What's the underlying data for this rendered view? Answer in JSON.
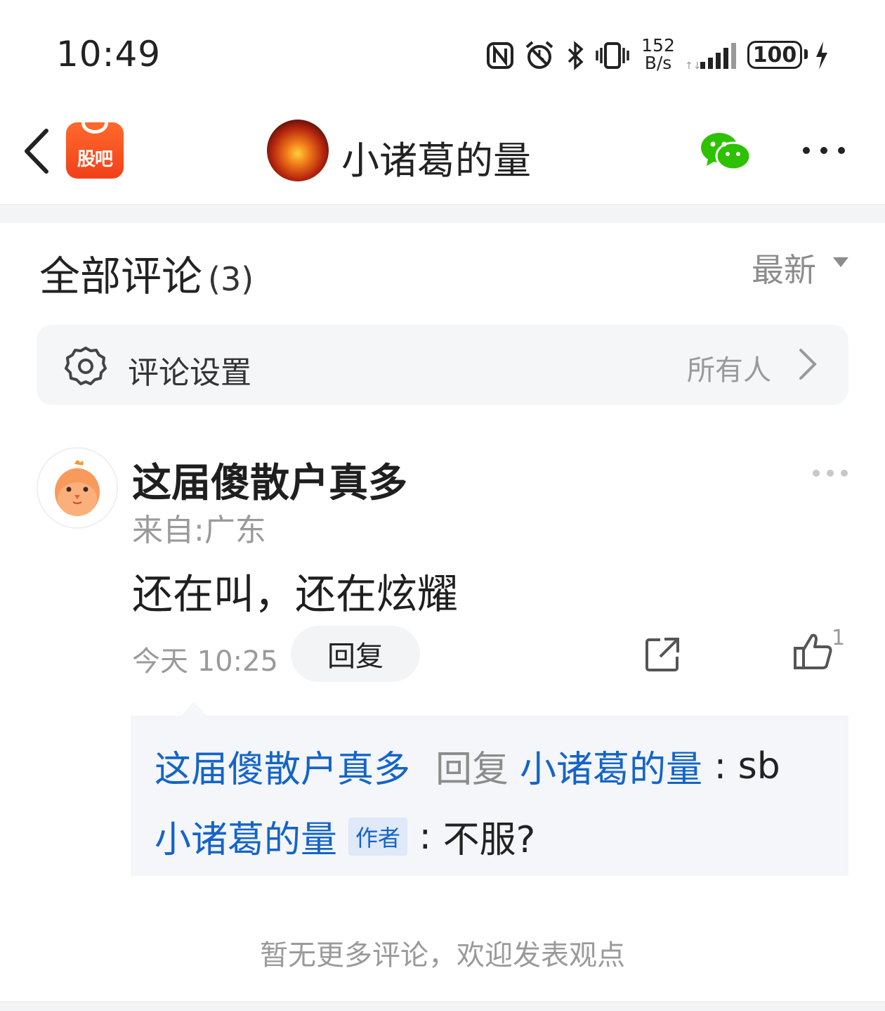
{
  "status_bar": {
    "time": "10:49",
    "net_speed_value": "152",
    "net_speed_unit": "B/s",
    "battery": "100",
    "icons": [
      "nfc-icon",
      "alarm-icon",
      "bluetooth-icon",
      "vibrate-icon",
      "signal-icon",
      "charging-icon"
    ]
  },
  "header": {
    "app_name": "股吧",
    "title": "小诸葛的量",
    "icons": [
      "back-arrow-icon",
      "wechat-icon",
      "more-icon"
    ],
    "app_color": "#f1401a"
  },
  "comments": {
    "title": "全部评论",
    "count": "(3)",
    "sort": "最新"
  },
  "settings": {
    "label": "评论设置",
    "value": "所有人"
  },
  "comment": {
    "author": "这届傻散户真多",
    "location": "来自:广东",
    "text": "还在叫，还在炫耀",
    "time": "今天 10:25",
    "reply_label": "回复",
    "like_count": "1"
  },
  "replies": [
    {
      "from": "这届傻散户真多",
      "verb": "回复",
      "to": "小诸葛的量",
      "sep": " : ",
      "text": "sb"
    },
    {
      "from": "小诸葛的量",
      "badge": "作者",
      "sep": " : ",
      "text": "不服?"
    }
  ],
  "footer": {
    "no_more": "暂无更多评论，欢迎发表观点"
  },
  "colors": {
    "link_blue": "#1464c8",
    "muted_gray": "#9a9a9a",
    "wechat_green": "#2dc100"
  }
}
